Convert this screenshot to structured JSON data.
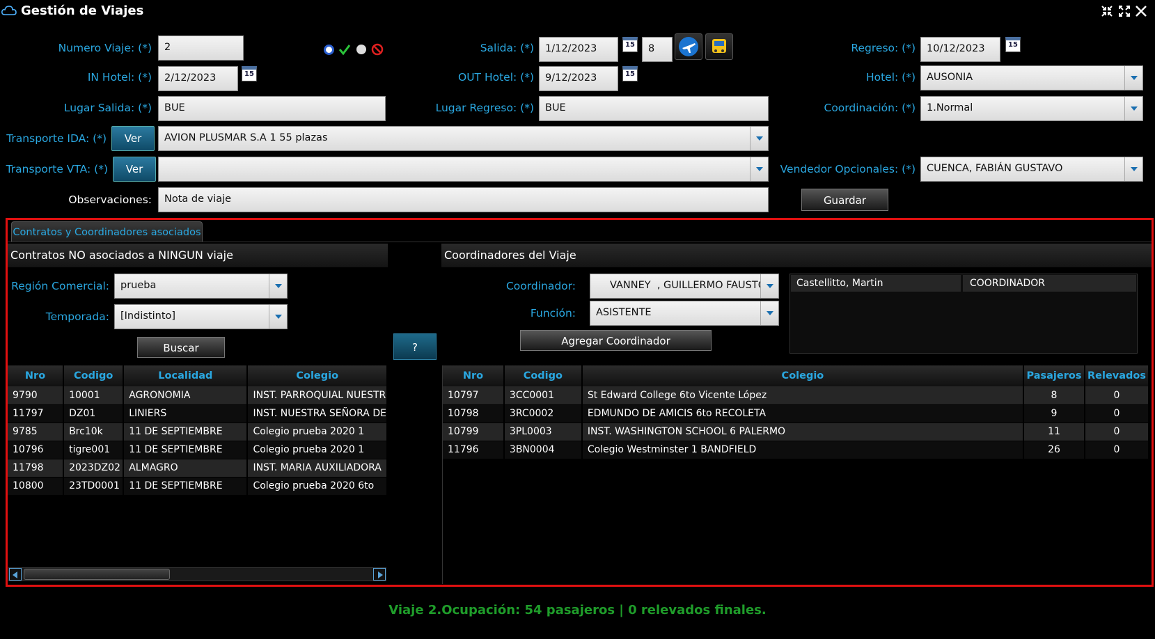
{
  "window": {
    "title": "Gestión de Viajes",
    "icons": [
      "cloud-icon",
      "collapse-icon",
      "expand-icon",
      "close-icon"
    ]
  },
  "form": {
    "numero_viaje": {
      "label": "Numero Viaje: (*)",
      "value": "2"
    },
    "salida": {
      "label": "Salida: (*)",
      "value": "1/12/2023",
      "days": "8"
    },
    "regreso": {
      "label": "Regreso: (*)",
      "value": "10/12/2023"
    },
    "in_hotel": {
      "label": "IN Hotel: (*)",
      "value": "2/12/2023"
    },
    "out_hotel": {
      "label": "OUT Hotel: (*)",
      "value": "9/12/2023"
    },
    "hotel": {
      "label": "Hotel: (*)",
      "value": "AUSONIA"
    },
    "lugar_salida": {
      "label": "Lugar Salida: (*)",
      "value": "BUE"
    },
    "lugar_regreso": {
      "label": "Lugar Regreso: (*)",
      "value": "BUE"
    },
    "coordinacion": {
      "label": "Coordinación: (*)",
      "value": "1.Normal"
    },
    "transporte_ida": {
      "label": "Transporte IDA: (*)",
      "button": "Ver",
      "value": "AVION PLUSMAR S.A 1 55 plazas"
    },
    "transporte_vta": {
      "label": "Transporte VTA: (*)",
      "button": "Ver",
      "value": ""
    },
    "vendedor": {
      "label": "Vendedor Opcionales: (*)",
      "value": "CUENCA, FABIÁN GUSTAVO"
    },
    "observaciones": {
      "label": "Observaciones:",
      "value": "Nota de viaje"
    },
    "guardar": "Guardar",
    "calendar_day": "15",
    "colors": {
      "label": "#2aa7e0",
      "status": "#1f9d2a",
      "highlight": "#e01010"
    }
  },
  "tab": {
    "label": "Contratos y Coordinadores asociados"
  },
  "left": {
    "title": "Contratos NO asociados a NINGUN viaje",
    "region": {
      "label": "Región Comercial:",
      "value": "prueba"
    },
    "temporada": {
      "label": "Temporada:",
      "value": "[Indistinto]"
    },
    "buscar": "Buscar",
    "columns": [
      "Nro",
      "Codigo",
      "Localidad",
      "Colegio"
    ],
    "rows": [
      [
        "9790",
        "10001",
        "AGRONOMIA",
        "INST. PARROQUIAL NUESTR"
      ],
      [
        "11797",
        "DZ01",
        "LINIERS",
        "INST. NUESTRA SEÑORA DE"
      ],
      [
        "9785",
        "Brc10k",
        "11 DE SEPTIEMBRE",
        "Colegio prueba 2020 1"
      ],
      [
        "10796",
        "tigre001",
        "11 DE SEPTIEMBRE",
        "Colegio prueba 2020 1"
      ],
      [
        "11798",
        "2023DZ02",
        "ALMAGRO",
        "INST. MARIA AUXILIADORA"
      ],
      [
        "10800",
        "23TD0001",
        "11 DE SEPTIEMBRE",
        "Colegio prueba 2020 6to"
      ]
    ]
  },
  "middle": {
    "button": "?"
  },
  "right": {
    "title": "Coordinadores del Viaje",
    "coordinador": {
      "label": "Coordinador:",
      "value": "VANNEY  , GUILLERMO FAUSTO"
    },
    "funcion": {
      "label": "Función:",
      "value": "ASISTENTE"
    },
    "agregar": "Agregar Coordinador",
    "assigned": [
      [
        "Castellitto, Martin",
        "COORDINADOR"
      ]
    ],
    "columns": [
      "Nro",
      "Codigo",
      "Colegio",
      "Pasajeros",
      "Relevados"
    ],
    "rows": [
      [
        "10797",
        "3CC0001",
        "St Edward College 6to Vicente López",
        "8",
        "0"
      ],
      [
        "10798",
        "3RC0002",
        "EDMUNDO DE AMICIS 6to RECOLETA",
        "9",
        "0"
      ],
      [
        "10799",
        "3PL0003",
        "INST. WASHINGTON SCHOOL 6 PALERMO",
        "11",
        "0"
      ],
      [
        "11796",
        "3BN0004",
        "Colegio Westminster 1 BANDFIELD",
        "26",
        "0"
      ]
    ]
  },
  "status": "Viaje 2.Ocupación: 54 pasajeros | 0 relevados finales."
}
